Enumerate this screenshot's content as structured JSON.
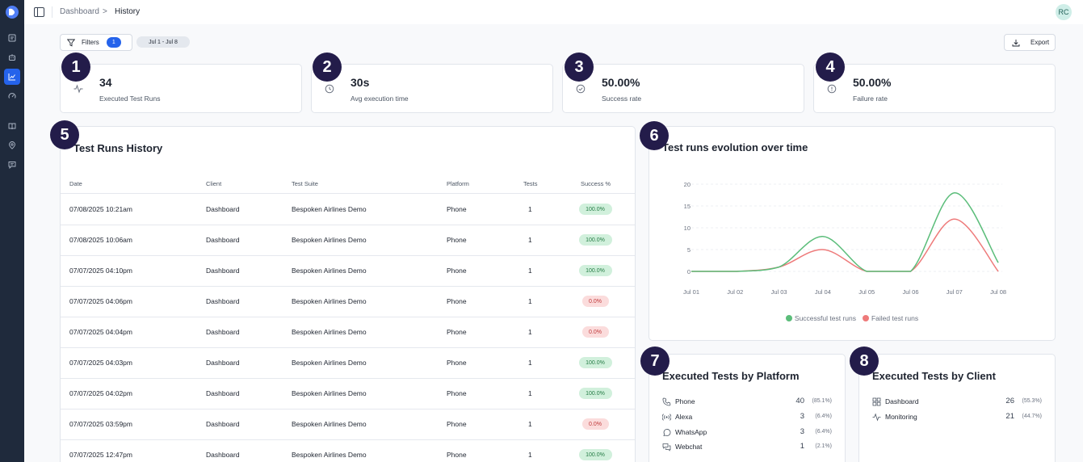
{
  "breadcrumb": {
    "parent": "Dashboard",
    "separator": ">",
    "current": "History"
  },
  "user": {
    "initials": "RC"
  },
  "toolbar": {
    "filters_label": "Filters",
    "filters_count": "1",
    "date_range": "Jul 1 - Jul 8",
    "export_label": "Export"
  },
  "stats": [
    {
      "badge": "1",
      "value": "34",
      "label": "Executed Test Runs",
      "icon": "activity-icon"
    },
    {
      "badge": "2",
      "value": "30s",
      "label": "Avg execution time",
      "icon": "clock-icon"
    },
    {
      "badge": "3",
      "value": "50.00%",
      "label": "Success rate",
      "icon": "check-circle-icon"
    },
    {
      "badge": "4",
      "value": "50.00%",
      "label": "Failure rate",
      "icon": "alert-circle-icon"
    }
  ],
  "history": {
    "badge": "5",
    "title": "Test Runs History",
    "columns": [
      "Date",
      "Client",
      "Test Suite",
      "Platform",
      "Tests",
      "Success %"
    ],
    "rows": [
      {
        "date": "07/08/2025 10:21am",
        "client": "Dashboard",
        "suite": "Bespoken Airlines Demo",
        "platform": "Phone",
        "tests": "1",
        "success": "100.0%",
        "status": "ok"
      },
      {
        "date": "07/08/2025 10:06am",
        "client": "Dashboard",
        "suite": "Bespoken Airlines Demo",
        "platform": "Phone",
        "tests": "1",
        "success": "100.0%",
        "status": "ok"
      },
      {
        "date": "07/07/2025 04:10pm",
        "client": "Dashboard",
        "suite": "Bespoken Airlines Demo",
        "platform": "Phone",
        "tests": "1",
        "success": "100.0%",
        "status": "ok"
      },
      {
        "date": "07/07/2025 04:06pm",
        "client": "Dashboard",
        "suite": "Bespoken Airlines Demo",
        "platform": "Phone",
        "tests": "1",
        "success": "0.0%",
        "status": "bad"
      },
      {
        "date": "07/07/2025 04:04pm",
        "client": "Dashboard",
        "suite": "Bespoken Airlines Demo",
        "platform": "Phone",
        "tests": "1",
        "success": "0.0%",
        "status": "bad"
      },
      {
        "date": "07/07/2025 04:03pm",
        "client": "Dashboard",
        "suite": "Bespoken Airlines Demo",
        "platform": "Phone",
        "tests": "1",
        "success": "100.0%",
        "status": "ok"
      },
      {
        "date": "07/07/2025 04:02pm",
        "client": "Dashboard",
        "suite": "Bespoken Airlines Demo",
        "platform": "Phone",
        "tests": "1",
        "success": "100.0%",
        "status": "ok"
      },
      {
        "date": "07/07/2025 03:59pm",
        "client": "Dashboard",
        "suite": "Bespoken Airlines Demo",
        "platform": "Phone",
        "tests": "1",
        "success": "0.0%",
        "status": "bad"
      },
      {
        "date": "07/07/2025 12:47pm",
        "client": "Dashboard",
        "suite": "Bespoken Airlines Demo",
        "platform": "Phone",
        "tests": "1",
        "success": "100.0%",
        "status": "ok"
      }
    ]
  },
  "evolution": {
    "badge": "6",
    "title": "Test runs evolution over time"
  },
  "chart_data": {
    "type": "line",
    "title": "Test runs evolution over time",
    "categories": [
      "Jul 01",
      "Jul 02",
      "Jul 03",
      "Jul 04",
      "Jul 05",
      "Jul 06",
      "Jul 07",
      "Jul 08"
    ],
    "y_ticks": [
      "0",
      "5",
      "10",
      "15",
      "20"
    ],
    "ylim": [
      0,
      20
    ],
    "grid": true,
    "legend_position": "bottom",
    "series": [
      {
        "name": "Successful test runs",
        "color": "#5bbd7a",
        "values": [
          0,
          0,
          1,
          8,
          0,
          0,
          18,
          2
        ]
      },
      {
        "name": "Failed test runs",
        "color": "#ee7a7a",
        "values": [
          0,
          0,
          1,
          5,
          0,
          0,
          12,
          0
        ]
      }
    ]
  },
  "platform": {
    "badge": "7",
    "title": "Executed Tests by Platform",
    "items": [
      {
        "icon": "phone-icon",
        "label": "Phone",
        "value": "40",
        "pct": "(85.1%)"
      },
      {
        "icon": "broadcast-icon",
        "label": "Alexa",
        "value": "3",
        "pct": "(6.4%)"
      },
      {
        "icon": "message-circle-icon",
        "label": "WhatsApp",
        "value": "3",
        "pct": "(6.4%)"
      },
      {
        "icon": "chat-bubbles-icon",
        "label": "Webchat",
        "value": "1",
        "pct": "(2.1%)"
      }
    ]
  },
  "client": {
    "badge": "8",
    "title": "Executed Tests by Client",
    "items": [
      {
        "icon": "grid-icon",
        "label": "Dashboard",
        "value": "26",
        "pct": "(55.3%)"
      },
      {
        "icon": "activity-icon",
        "label": "Monitoring",
        "value": "21",
        "pct": "(44.7%)"
      }
    ]
  },
  "colors": {
    "accent": "#2563eb",
    "rail": "#1f2a3c",
    "badge": "#231c4a",
    "success": "#5bbd7a",
    "failure": "#ee7a7a"
  }
}
